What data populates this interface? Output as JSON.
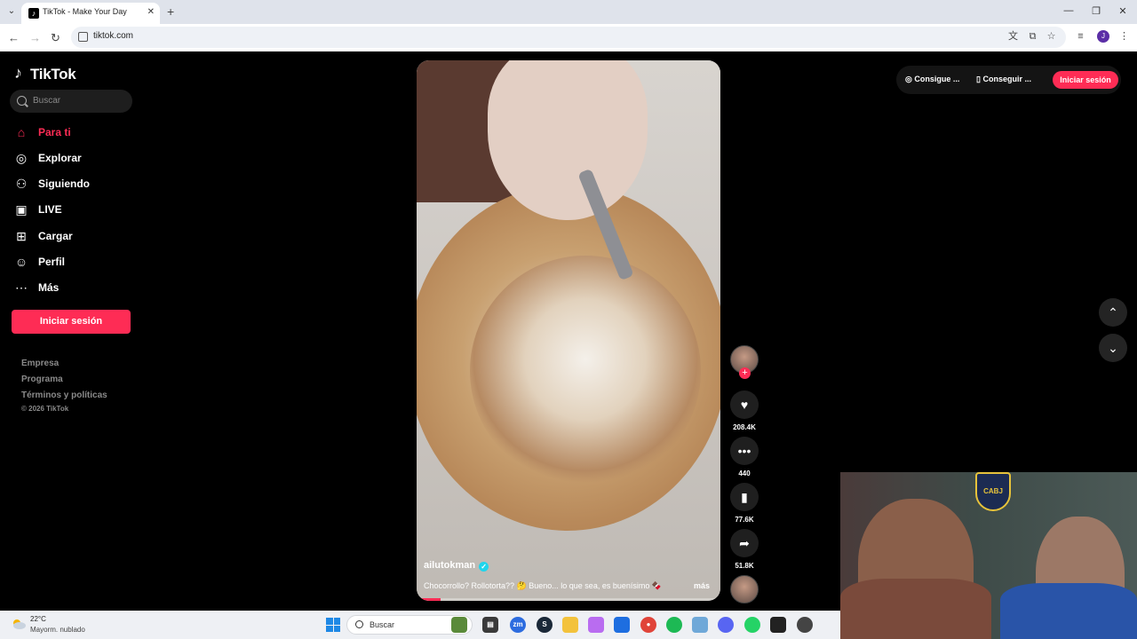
{
  "browser": {
    "tab_title": "TikTok - Make Your Day",
    "url": "tiktok.com",
    "profile_initial": "J"
  },
  "sidebar": {
    "brand": "TikTok",
    "search_placeholder": "Buscar",
    "nav": [
      {
        "label": "Para ti",
        "icon": "home-icon"
      },
      {
        "label": "Explorar",
        "icon": "compass-icon"
      },
      {
        "label": "Siguiendo",
        "icon": "following-icon"
      },
      {
        "label": "LIVE",
        "icon": "live-icon"
      },
      {
        "label": "Cargar",
        "icon": "upload-icon"
      },
      {
        "label": "Perfil",
        "icon": "profile-icon"
      },
      {
        "label": "Más",
        "icon": "more-icon"
      }
    ],
    "login_button": "Iniciar sesión",
    "footer_links": [
      "Empresa",
      "Programa",
      "Términos y políticas"
    ],
    "copyright": "© 2026 TikTok"
  },
  "header": {
    "get_coins": "Consigue ...",
    "get_app": "Conseguir ...",
    "login_button": "Iniciar sesión"
  },
  "video": {
    "author": "ailutokman",
    "caption": "Chocorrollo? Rollotorta?? 🤔 Bueno... lo que sea, es buenísimo 🍫",
    "more_label": "más",
    "progress": 0.08,
    "likes": "208.4K",
    "comments": "440",
    "saves": "77.6K",
    "shares": "51.8K"
  },
  "webcam": {
    "badge_text": "CABJ"
  },
  "taskbar": {
    "weather_temp": "22°C",
    "weather_desc": "Mayorm. nublado",
    "search_placeholder": "Buscar"
  },
  "colors": {
    "accent": "#fe2c55",
    "verified": "#20d5ec"
  }
}
